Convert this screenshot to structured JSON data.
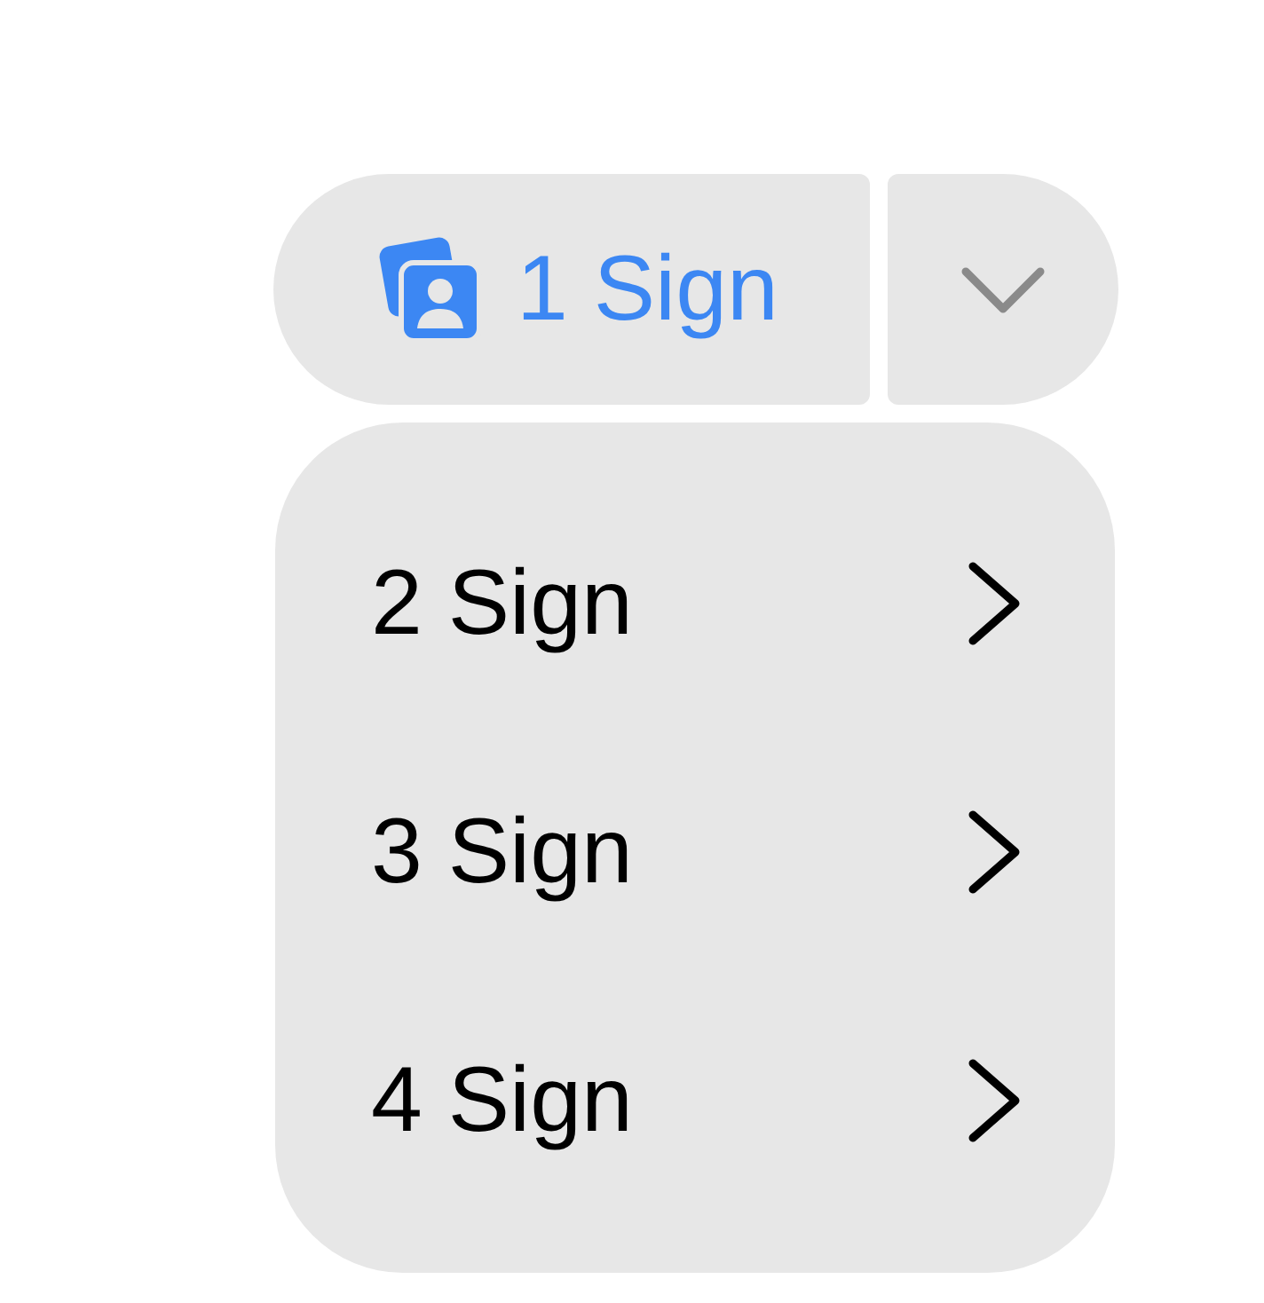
{
  "split_button": {
    "label": "1 Sign"
  },
  "menu": {
    "items": [
      {
        "label": "2 Sign"
      },
      {
        "label": "3 Sign"
      },
      {
        "label": "4 Sign"
      }
    ]
  }
}
